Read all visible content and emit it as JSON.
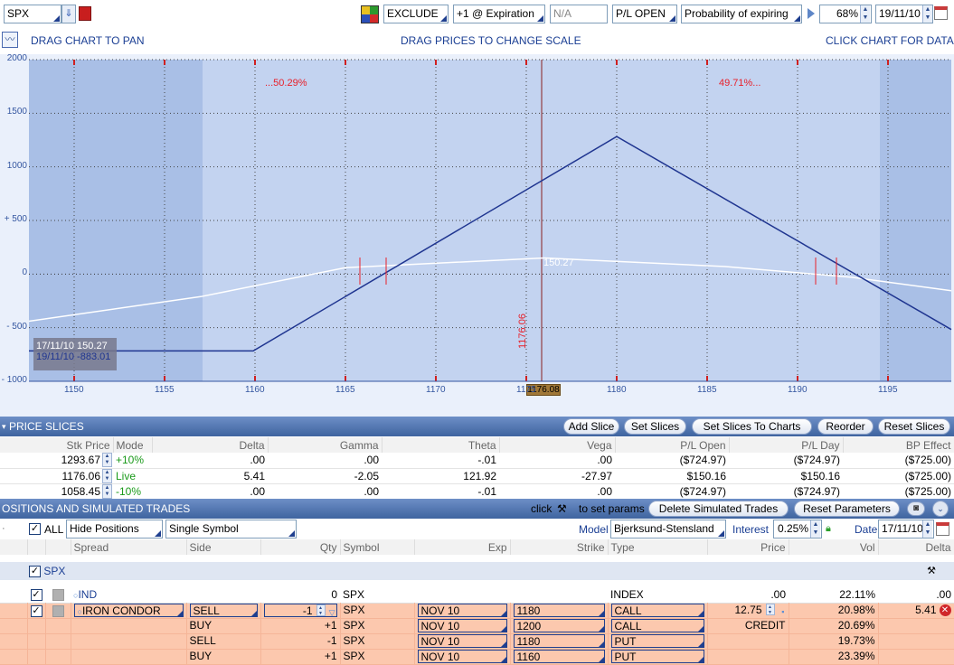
{
  "toolbar": {
    "symbol": "SPX",
    "exclude": "EXCLUDE",
    "expiration": "+1 @ Expiration",
    "na": "N/A",
    "pl_mode": "P/L OPEN",
    "probability": "Probability of expiring",
    "pct": "68%",
    "date": "19/11/10"
  },
  "chart_header": {
    "drag_pan": "DRAG CHART TO PAN",
    "drag_prices": "DRAG PRICES TO CHANGE SCALE",
    "click_data": "CLICK CHART FOR DATA"
  },
  "chart_data": {
    "type": "line",
    "x_ticks": [
      "1150",
      "1155",
      "1160",
      "1165",
      "1170",
      "1175",
      "1180",
      "1185",
      "1190",
      "1195"
    ],
    "y_ticks": [
      "2000",
      "1500",
      "1000",
      "+ 500",
      "0",
      "- 500",
      "- 1000"
    ],
    "xlim": [
      1147.5,
      1198.5
    ],
    "ylim": [
      -1000,
      2000
    ],
    "series": [
      {
        "values": [
          [
            1147.5,
            -717
          ],
          [
            1159.9,
            -717
          ],
          [
            1180,
            1283
          ],
          [
            1198.5,
            -517
          ]
        ]
      },
      {
        "values": [
          [
            1147.5,
            -440
          ],
          [
            1157,
            -210
          ],
          [
            1165,
            60
          ],
          [
            1176,
            150
          ],
          [
            1186,
            70
          ],
          [
            1193,
            -30
          ],
          [
            1198.5,
            -155
          ]
        ]
      }
    ],
    "prob_left": "...50.29%",
    "prob_right": "49.71%...",
    "current_price_label": "1176.06",
    "current_price_axis": "1176.08",
    "curve_value_label": "150.27",
    "tooltip_line1": "17/11/10  150.27",
    "tooltip_line2": "19/11/10 -883.01"
  },
  "price_slices": {
    "title": "PRICE SLICES",
    "buttons": [
      "Add Slice",
      "Set Slices",
      "Set Slices To Charts",
      "Reorder",
      "Reset Slices"
    ],
    "headers": [
      "Stk Price",
      "Mode",
      "Delta",
      "Gamma",
      "Theta",
      "Vega",
      "P/L Open",
      "P/L Day",
      "BP Effect"
    ],
    "rows": [
      [
        "1293.67",
        "+10%",
        ".00",
        ".00",
        "-.01",
        ".00",
        "($724.97)",
        "($724.97)",
        "($725.00)"
      ],
      [
        "1176.06",
        "Live",
        "5.41",
        "-2.05",
        "121.92",
        "-27.97",
        "$150.16",
        "$150.16",
        "($725.00)"
      ],
      [
        "1058.45",
        "-10%",
        ".00",
        ".00",
        "-.01",
        ".00",
        "($724.97)",
        "($724.97)",
        "($725.00)"
      ]
    ]
  },
  "positions": {
    "title": "OSITIONS AND SIMULATED TRADES",
    "click_label": "click",
    "to_set_params": "to set params",
    "delete_btn": "Delete Simulated Trades",
    "reset_btn": "Reset Parameters",
    "all_label": "ALL",
    "hide_positions": "Hide Positions",
    "single_symbol": "Single Symbol",
    "model_label": "Model",
    "model_value": "Bjerksund-Stensland",
    "interest_label": "Interest",
    "interest_value": "0.25%",
    "date_label": "Date",
    "date_value": "17/11/10",
    "headers": [
      "Spread",
      "Side",
      "Qty",
      "Symbol",
      "Exp",
      "Strike",
      "Type",
      "Price",
      "Vol",
      "Delta"
    ],
    "group": "SPX",
    "ind_row": {
      "spread": "IND",
      "qty": "0",
      "symbol": "SPX",
      "type": "INDEX",
      "price": ".00",
      "vol": "22.11%",
      "delta": ".00"
    },
    "legs": [
      {
        "spread": "IRON CONDOR",
        "side": "SELL",
        "qty": "-1",
        "symbol": "SPX",
        "exp": "NOV 10",
        "strike": "1180",
        "type": "CALL",
        "price": "12.75",
        "vol": "20.98%",
        "delta": "5.41"
      },
      {
        "spread": "",
        "side": "BUY",
        "qty": "+1",
        "symbol": "SPX",
        "exp": "NOV 10",
        "strike": "1200",
        "type": "CALL",
        "price": "CREDIT",
        "vol": "20.69%",
        "delta": ""
      },
      {
        "spread": "",
        "side": "SELL",
        "qty": "-1",
        "symbol": "SPX",
        "exp": "NOV 10",
        "strike": "1180",
        "type": "PUT",
        "price": "",
        "vol": "19.73%",
        "delta": ""
      },
      {
        "spread": "",
        "side": "BUY",
        "qty": "+1",
        "symbol": "SPX",
        "exp": "NOV 10",
        "strike": "1160",
        "type": "PUT",
        "price": "",
        "vol": "23.39%",
        "delta": ""
      }
    ]
  },
  "colors": {
    "chart_bg": "#c3d3f0",
    "chart_side": "#a9bfe6",
    "pl_line": "#1f3590",
    "theo_line": "#ffffff",
    "prob_text": "#e8202a",
    "salmon": "#fcc8ae"
  }
}
